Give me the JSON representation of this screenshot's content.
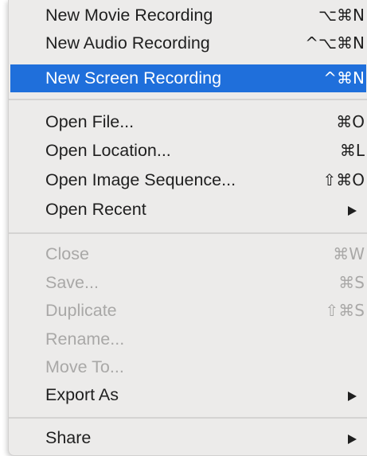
{
  "menu": {
    "sections": [
      {
        "items": [
          {
            "label": "New Movie Recording",
            "shortcut": "⌥⌘N",
            "enabled": true,
            "highlighted": false
          },
          {
            "label": "New Audio Recording",
            "shortcut": "^⌥⌘N",
            "enabled": true,
            "highlighted": false
          },
          {
            "label": "New Screen Recording",
            "shortcut": "^⌘N",
            "enabled": true,
            "highlighted": true
          }
        ]
      },
      {
        "items": [
          {
            "label": "Open File...",
            "shortcut": "⌘O",
            "enabled": true,
            "highlighted": false
          },
          {
            "label": "Open Location...",
            "shortcut": "⌘L",
            "enabled": true,
            "highlighted": false
          },
          {
            "label": "Open Image Sequence...",
            "shortcut": "⇧⌘O",
            "enabled": true,
            "highlighted": false
          },
          {
            "label": "Open Recent",
            "submenu_icon": "triangle-right-icon",
            "enabled": true,
            "highlighted": false
          }
        ]
      },
      {
        "items": [
          {
            "label": "Close",
            "shortcut": "⌘W",
            "enabled": false,
            "highlighted": false
          },
          {
            "label": "Save...",
            "shortcut": "⌘S",
            "enabled": false,
            "highlighted": false
          },
          {
            "label": "Duplicate",
            "shortcut": "⇧⌘S",
            "enabled": false,
            "highlighted": false
          },
          {
            "label": "Rename...",
            "enabled": false,
            "highlighted": false
          },
          {
            "label": "Move To...",
            "enabled": false,
            "highlighted": false
          },
          {
            "label": "Export As",
            "submenu_icon": "triangle-right-icon",
            "enabled": true,
            "highlighted": false
          }
        ]
      },
      {
        "items": [
          {
            "label": "Share",
            "submenu_icon": "triangle-right-icon",
            "enabled": true,
            "highlighted": false
          }
        ]
      }
    ],
    "colors": {
      "background": "#ecebea",
      "highlight": "#1f6fdb",
      "text": "#1f1f1f",
      "disabled_text": "#a9a8a7"
    }
  }
}
